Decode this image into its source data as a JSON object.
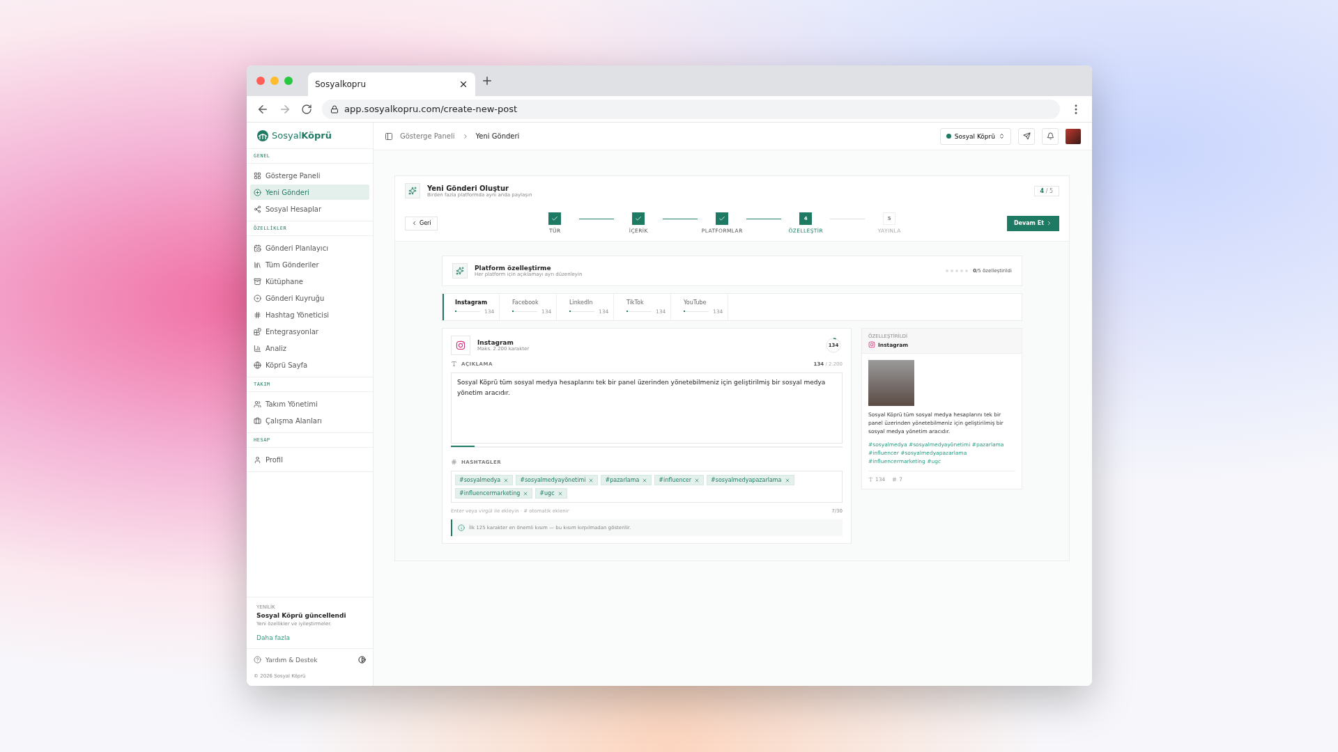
{
  "browser": {
    "tab_title": "Sosyalkopru",
    "url": "app.sosyalkopru.com/create-new-post"
  },
  "sidebar": {
    "logo": {
      "light": "Sosyal",
      "bold": "Köprü"
    },
    "sections": [
      {
        "title": "GENEL",
        "items": [
          {
            "label": "Gösterge Paneli",
            "selected": false
          },
          {
            "label": "Yeni Gönderi",
            "selected": true
          },
          {
            "label": "Sosyal Hesaplar",
            "selected": false
          }
        ]
      },
      {
        "title": "ÖZELLİKLER",
        "items": [
          {
            "label": "Gönderi Planlayıcı",
            "selected": false
          },
          {
            "label": "Tüm Gönderiler",
            "selected": false
          },
          {
            "label": "Kütüphane",
            "selected": false
          },
          {
            "label": "Gönderi Kuyruğu",
            "selected": false
          },
          {
            "label": "Hashtag Yöneticisi",
            "selected": false
          },
          {
            "label": "Entegrasyonlar",
            "selected": false
          },
          {
            "label": "Analiz",
            "selected": false
          },
          {
            "label": "Köprü Sayfa",
            "selected": false
          }
        ]
      },
      {
        "title": "TAKIM",
        "items": [
          {
            "label": "Takım Yönetimi",
            "selected": false
          },
          {
            "label": "Çalışma Alanları",
            "selected": false
          }
        ]
      },
      {
        "title": "HESAP",
        "items": [
          {
            "label": "Profil",
            "selected": false
          }
        ]
      }
    ],
    "news": {
      "eyebrow": "YENİLİK",
      "title": "Sosyal Köprü güncellendi",
      "text": "Yeni özellikler ve iyileştirmeler.",
      "link": "Daha fazla"
    },
    "help": "Yardım & Destek",
    "copyright": "© 2026 Sosyal Köprü"
  },
  "topbar": {
    "breadcrumbs": [
      "Gösterge Paneli",
      "Yeni Gönderi"
    ],
    "workspace": "Sosyal Köprü"
  },
  "wizard": {
    "title": "Yeni Gönderi Oluştur",
    "subtitle": "Birden fazla platformda aynı anda paylaşın",
    "step_counter": "**4** / 5",
    "back": "Geri",
    "next": "Devam Et",
    "steps": [
      {
        "label": "TÜR",
        "kind": "done"
      },
      {
        "label": "İÇERİK",
        "kind": "done"
      },
      {
        "label": "PLATFORMLAR",
        "kind": "done"
      },
      {
        "label": "ÖZELLEŞTİR",
        "number": "4",
        "kind": "current"
      },
      {
        "label": "YAYINLA",
        "number": "5",
        "kind": "upcoming"
      }
    ]
  },
  "customize": {
    "title": "Platform özelleştirme",
    "subtitle": "Her platform için açıklamayı ayrı düzenleyin",
    "dots": [
      {
        "filled": false
      },
      {
        "filled": false
      },
      {
        "filled": false
      },
      {
        "filled": false
      },
      {
        "filled": false
      }
    ],
    "status": "**0**/5 özelleştirildi",
    "platforms": [
      {
        "kind": "instagram",
        "name": "Instagram",
        "count": "134",
        "level": 0.06,
        "selected": true
      },
      {
        "kind": "facebook",
        "name": "Facebook",
        "count": "134",
        "level": 0.02,
        "selected": false
      },
      {
        "kind": "linkedin",
        "name": "LinkedIn",
        "count": "134",
        "level": 0.04,
        "selected": false
      },
      {
        "kind": "tiktok",
        "name": "TikTok",
        "count": "134",
        "level": 0.02,
        "selected": false
      },
      {
        "kind": "youtube",
        "name": "YouTube",
        "count": "134",
        "level": 0.02,
        "selected": false
      }
    ]
  },
  "editor": {
    "platform": "Instagram",
    "max": "Maks. 2.200 karakter",
    "counter": {
      "text": "134",
      "level": 0.06
    },
    "description_label": "AÇIKLAMA",
    "chars": "134",
    "chars_max": "/ 2.200",
    "description": {
      "text": "Sosyal Köprü tüm sosyal medya hesaplarını tek bir panel üzerinden yönetebilmeniz için geliştirilmiş bir sosyal medya yönetim aracıdır.",
      "level": 0.06
    },
    "hashtags_label": "HASHTAGLER",
    "hashtags": [
      "#sosyalmedya",
      "#sosyalmedyayönetimi",
      "#pazarlama",
      "#influencer",
      "#sosyalmedyapazarlama",
      "#influencermarketing",
      "#ugc"
    ],
    "hint": "Enter veya virgül ile ekleyin · # otomatik eklenir",
    "tag_count": "7/30",
    "info": "İlk 125 karakter en önemli kısım — bu kısım kırpılmadan gösterilir."
  },
  "preview": {
    "eyebrow": "ÖZELLEŞTİRİLDİ",
    "platform": "Instagram",
    "text": "Sosyal Köprü tüm sosyal medya hesaplarını tek bir panel üzerinden yönetebilmeniz için geliştirilmiş bir sosyal medya yönetim aracıdır.",
    "hashtags": "#sosyalmedya #sosyalmedyayönetimi #pazarlama #influencer #sosyalmedyapazarlama #influencermarketing #ugc",
    "chars": "134",
    "tags": "7"
  }
}
